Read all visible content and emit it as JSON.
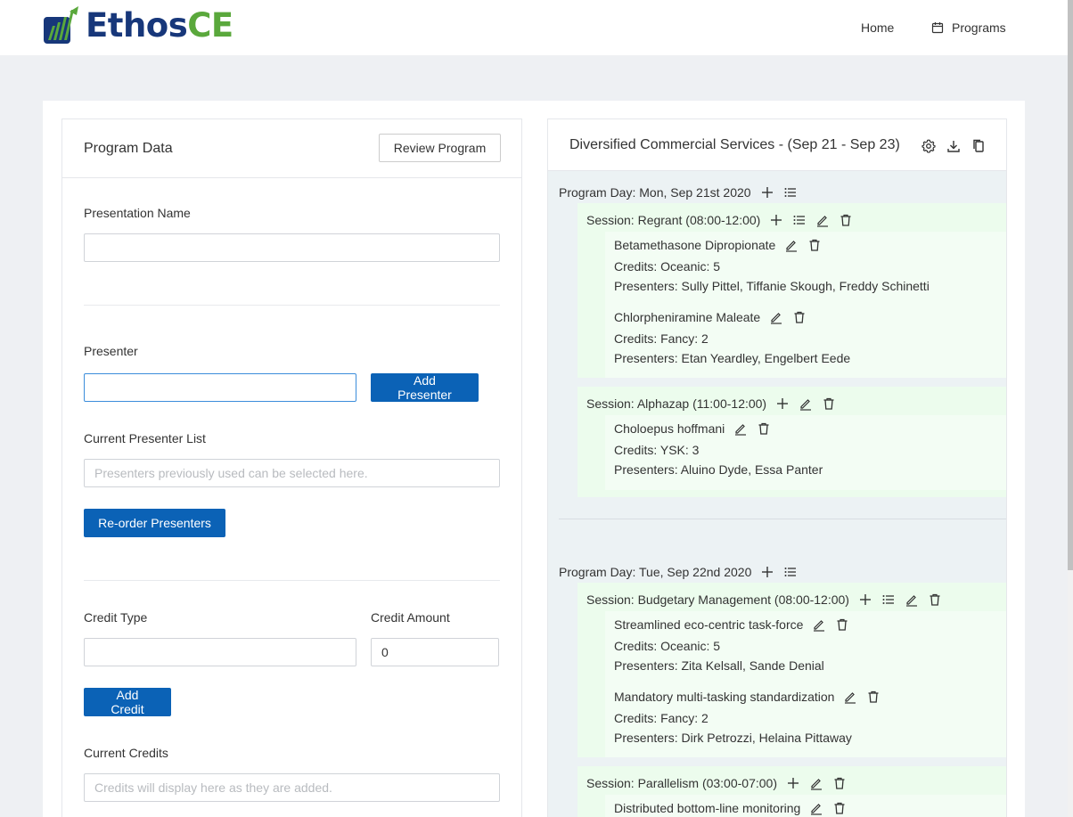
{
  "header": {
    "logo": {
      "part1": "Ethos",
      "part2": "CE"
    },
    "nav": {
      "home": "Home",
      "programs": "Programs"
    },
    "colors": {
      "brand_blue": "#17377a",
      "brand_green": "#5aa83c",
      "primary": "#0b62b6"
    }
  },
  "left": {
    "title": "Program Data",
    "review_button": "Review Program",
    "presentation_name_label": "Presentation Name",
    "presentation_name_value": "",
    "presenter_label": "Presenter",
    "presenter_value": "",
    "add_presenter_button": "Add Presenter",
    "current_presenter_label": "Current Presenter List",
    "current_presenter_placeholder": "Presenters previously used can be selected here.",
    "reorder_button": "Re-order Presenters",
    "credit_type_label": "Credit Type",
    "credit_type_value": "",
    "credit_amount_label": "Credit Amount",
    "credit_amount_value": "0",
    "add_credit_button": "Add Credit",
    "current_credits_label": "Current Credits",
    "current_credits_placeholder": "Credits will display here as they are added."
  },
  "right": {
    "title": "Diversified Commercial Services - (Sep 21 - Sep 23)",
    "icons": [
      "gear-icon",
      "download-icon",
      "copy-icon"
    ],
    "days": [
      {
        "label": "Program Day: Mon, Sep 21st 2020",
        "sessions": [
          {
            "label": "Session: Regrant (08:00-12:00)",
            "presentations": [
              {
                "name": "Betamethasone Dipropionate",
                "credits": "Credits: Oceanic: 5",
                "presenters": "Presenters: Sully Pittel, Tiffanie Skough, Freddy Schinetti"
              },
              {
                "name": "Chlorpheniramine Maleate",
                "credits": "Credits: Fancy: 2",
                "presenters": "Presenters: Etan Yeardley, Engelbert Eede"
              }
            ]
          },
          {
            "label": "Session: Alphazap (11:00-12:00)",
            "presentations": [
              {
                "name": "Choloepus hoffmani",
                "credits": "Credits: YSK: 3",
                "presenters": "Presenters: Aluino Dyde, Essa Panter"
              }
            ]
          }
        ]
      },
      {
        "label": "Program Day: Tue, Sep 22nd 2020",
        "sessions": [
          {
            "label": "Session: Budgetary Management (08:00-12:00)",
            "presentations": [
              {
                "name": "Streamlined eco-centric task-force",
                "credits": "Credits: Oceanic: 5",
                "presenters": "Presenters: Zita Kelsall, Sande Denial"
              },
              {
                "name": "Mandatory multi-tasking standardization",
                "credits": "Credits: Fancy: 2",
                "presenters": "Presenters: Dirk Petrozzi, Helaina Pittaway"
              }
            ]
          },
          {
            "label": "Session: Parallelism (03:00-07:00)",
            "presentations": [
              {
                "name": "Distributed bottom-line monitoring",
                "credits": "",
                "presenters": ""
              }
            ]
          }
        ]
      }
    ]
  }
}
